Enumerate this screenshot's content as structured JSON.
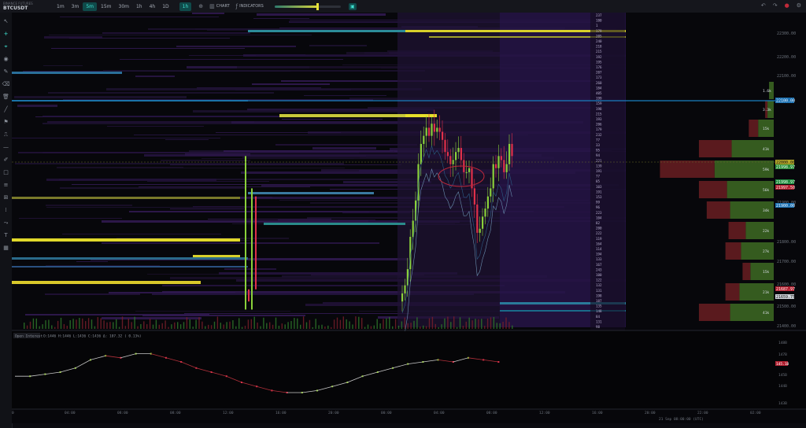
{
  "header": {
    "exchange": "BINANCE FUTURES",
    "symbol": "BTCUSDT",
    "timeframes": [
      {
        "label": "1m",
        "active": false
      },
      {
        "label": "3m",
        "active": false
      },
      {
        "label": "5m",
        "active": true
      },
      {
        "label": "15m",
        "active": false
      },
      {
        "label": "30m",
        "active": false
      },
      {
        "label": "1h",
        "active": false
      },
      {
        "label": "4h",
        "active": false
      },
      {
        "label": "1D",
        "active": false
      }
    ],
    "interval_badge": "1h",
    "chart_label": "CHART",
    "indicators_label": "INDICATORS",
    "heatmap_intensity": 0.65
  },
  "indicator": {
    "label": "Open Interest",
    "values": "O:1446 H:1446 L:1436 C:1436 Δ: 107.32 ( 0.13%)"
  },
  "price_axis": [
    "22300.00",
    "22200.00",
    "22100.00",
    "21900.00",
    "21800.00",
    "21700.00",
    "21600.00",
    "21500.00",
    "21400.00"
  ],
  "price_tags": {
    "blue_top": "22100.00",
    "yellow": "22000.00",
    "green": "21998.97",
    "red": "21997.50",
    "blue_mid": "21900.00",
    "red_low": "21687.97",
    "white_low": "21659.75"
  },
  "oi_axis": [
    "148B",
    "147B",
    "146B",
    "145B",
    "144B",
    "143B"
  ],
  "oi_tag": "145.1B",
  "time_axis": [
    "0",
    "04:00",
    "08:00",
    "08:00",
    "12:00",
    "16:00",
    "20:00",
    "00:00",
    "04:00",
    "08:00",
    "12:00",
    "16:00",
    "20:00",
    "22:00",
    "02:00",
    "02:00",
    "04:00",
    "06:00"
  ],
  "bottom_status": "21 Sep  08:00:00 (UTC)",
  "book_labels": [
    "237",
    "180",
    "1",
    "179",
    "205",
    "240",
    "218",
    "215",
    "192",
    "195",
    "176",
    "207",
    "173",
    "260",
    "184",
    "405",
    "199",
    "159",
    "198",
    "215",
    "193",
    "206",
    "179",
    "232",
    "77",
    "33",
    "95",
    "94",
    "221",
    "139",
    "191",
    "77",
    "85",
    "103",
    "191",
    "153",
    "99",
    "96",
    "223",
    "104",
    "82",
    "200",
    "222",
    "119",
    "164",
    "114",
    "194",
    "133",
    "167",
    "243",
    "100",
    "122",
    "132",
    "131",
    "198",
    "187",
    "135",
    "148",
    "84",
    "131",
    "98"
  ],
  "volume_profile": {
    "labels": [
      "1.6k",
      "3.3k",
      "15k",
      "41k",
      "59k",
      "56k",
      "34k",
      "22k",
      "27k",
      "15k",
      "21k",
      "41k"
    ],
    "buy": [
      0.06,
      0.08,
      0.2,
      0.54,
      0.76,
      0.6,
      0.56,
      0.36,
      0.42,
      0.3,
      0.44,
      0.56
    ],
    "sell": [
      0.0,
      0.03,
      0.12,
      0.42,
      0.7,
      0.36,
      0.3,
      0.22,
      0.2,
      0.1,
      0.18,
      0.4
    ]
  },
  "chart_data": {
    "type": "candlestick",
    "close": [
      21640,
      21660,
      21700,
      21780,
      21820,
      21870,
      21960,
      22010,
      22030,
      22050,
      22030,
      22060,
      22040,
      22050,
      22040,
      22020,
      21990,
      21980,
      21960,
      21970,
      21990,
      22000,
      21970,
      21940,
      21940,
      21950,
      21900,
      21860,
      21790,
      21800,
      21830,
      21850,
      21880,
      21900,
      21960,
      21950,
      21980,
      21970,
      21940,
      21960,
      22010,
      21980
    ],
    "open_interest": [
      144.8,
      144.8,
      144.9,
      145.0,
      145.2,
      145.6,
      145.8,
      145.7,
      145.9,
      145.9,
      145.7,
      145.5,
      145.2,
      145.0,
      144.8,
      144.5,
      144.3,
      144.1,
      144.0,
      144.0,
      144.1,
      144.3,
      144.5,
      144.8,
      145.0,
      145.2,
      145.4,
      145.5,
      145.6,
      145.5,
      145.7,
      145.6,
      145.5
    ]
  }
}
